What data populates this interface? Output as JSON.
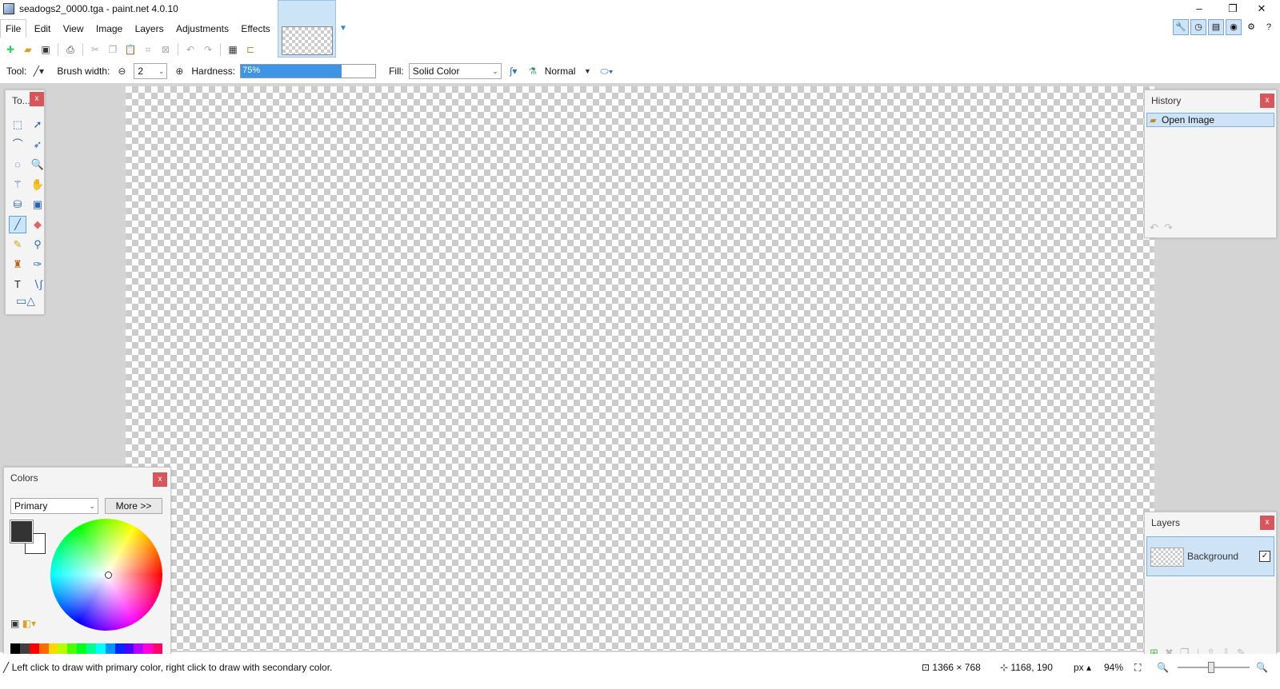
{
  "window": {
    "title": "seadogs2_0000.tga - paint.net 4.0.10",
    "minimize": "–",
    "restore": "❐",
    "close": "✕"
  },
  "menu": [
    "File",
    "Edit",
    "View",
    "Image",
    "Layers",
    "Adjustments",
    "Effects"
  ],
  "toolbar2": {
    "tool_label": "Tool:",
    "brush_width_label": "Brush width:",
    "brush_width_value": "2",
    "hardness_label": "Hardness:",
    "hardness_value": "75%",
    "hardness_fraction": 0.75,
    "fill_label": "Fill:",
    "fill_value": "Solid Color",
    "blend_mode": "Normal"
  },
  "tools_panel": {
    "title": "To...",
    "close": "x"
  },
  "history_panel": {
    "title": "History",
    "close": "x",
    "items": [
      "Open Image"
    ]
  },
  "layers_panel": {
    "title": "Layers",
    "close": "x",
    "layers": [
      {
        "name": "Background",
        "visible": "✓"
      }
    ]
  },
  "colors_panel": {
    "title": "Colors",
    "close": "x",
    "mode": "Primary",
    "more_label": "More >>",
    "primary_color": "#333333",
    "secondary_color": "#ffffff"
  },
  "status": {
    "hint": "Left click to draw with primary color, right click to draw with secondary color.",
    "image_size": "1366 × 768",
    "cursor_pos": "1168, 190",
    "units": "px",
    "zoom": "94%"
  },
  "palette": [
    "#000000",
    "#404040",
    "#ff0000",
    "#ff6a00",
    "#ffd800",
    "#b6ff00",
    "#4cff00",
    "#00ff21",
    "#00ff90",
    "#00ffff",
    "#0094ff",
    "#0026ff",
    "#4800ff",
    "#b200ff",
    "#ff00dc",
    "#ff006e"
  ]
}
